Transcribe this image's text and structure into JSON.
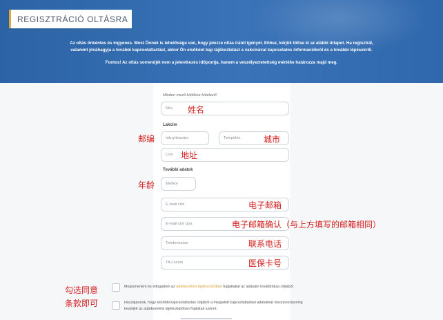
{
  "header": {
    "title": "REGISZTRÁCIÓ OLTÁSRA",
    "intro_line1": "Az oltás önkéntes és ingyenes. Most Önnek is lehetősége van, hogy jelezze oltás iránti igényét. Ehhez, kérjük töltse ki az alábbi űrlapot. Ha regisztrál,",
    "intro_line2": "valamint jóváhagyja a további kapcsolattartást, akkor Ön elsőként kap tájékoztatást a vakcinával kapcsolatos információkról és a további lépésekről.",
    "note": "Fontos! Az oltás sorrendjét nem a jelentkezés időpontja, hanem a veszélyeztetettség mértéke határozza majd meg."
  },
  "form": {
    "required_note": "Minden mező kitöltése kötelező!",
    "name": {
      "placeholder": "Név",
      "annotation": "姓名"
    },
    "lakcim": {
      "label": "Lakcím",
      "zip": {
        "placeholder": "Irányítószám",
        "annotation": "邮编"
      },
      "city": {
        "placeholder": "Település",
        "annotation": "城市"
      },
      "address": {
        "placeholder": "Cím",
        "annotation": "地址"
      }
    },
    "tovabbi": {
      "label": "További adatok",
      "age": {
        "placeholder": "Életkor",
        "annotation": "年龄"
      },
      "email": {
        "placeholder": "E-mail cím",
        "annotation": "电子邮箱"
      },
      "email_confirm": {
        "placeholder": "E-mail cím újra",
        "annotation": "电子邮箱确认（与上方填写的邮箱相同）"
      },
      "phone": {
        "placeholder": "Telefonszám",
        "annotation": "联系电话"
      },
      "taj": {
        "placeholder": "TAJ szám",
        "annotation": "医保卡号"
      }
    },
    "consent_annotation_line1": "勾选同意",
    "consent_annotation_line2": "条款即可",
    "consent1": {
      "prefix": "Megismertem és elfogadom az",
      "link": "adatkezelési tájékoztatóban",
      "suffix": "foglaltakat az adataim továbbítása céljából"
    },
    "consent2": {
      "line1": "Hozzájárulok, hogy későbbi kapcsolattartás céljából a megadott kapcsolattartási adataimat visszavonásomig",
      "line2": "kezeljék az adatkezelési tájékoztatóban foglaltak szerint."
    }
  },
  "colors": {
    "header_bg": "#2c63a6",
    "accent": "#e0a83a",
    "annotation": "#d21f1f"
  }
}
